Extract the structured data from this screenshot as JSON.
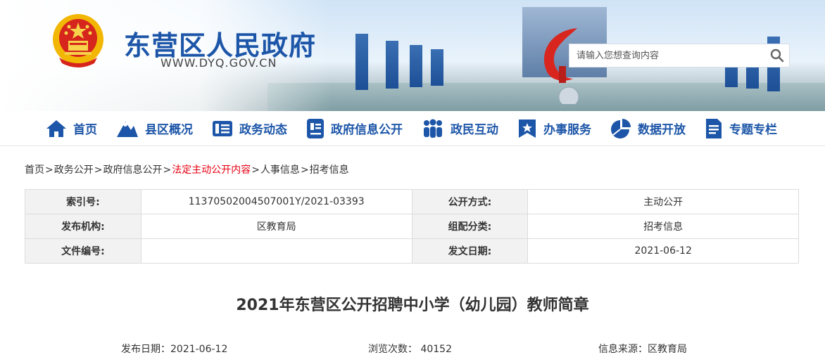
{
  "header": {
    "site_title": "东营区人民政府",
    "site_url": "WWW.DYQ.GOV.CN",
    "search_placeholder": "请输入您想查询内容",
    "brand_color": "#1d56a8"
  },
  "nav": [
    {
      "label": "首页",
      "icon": "home-icon"
    },
    {
      "label": "县区概况",
      "icon": "mountain-icon"
    },
    {
      "label": "政务动态",
      "icon": "news-icon"
    },
    {
      "label": "政府信息公开",
      "icon": "info-card-icon"
    },
    {
      "label": "政民互动",
      "icon": "people-icon"
    },
    {
      "label": "办事服务",
      "icon": "service-bookmark-icon"
    },
    {
      "label": "数据开放",
      "icon": "pie-chart-icon"
    },
    {
      "label": "专题专栏",
      "icon": "document-icon"
    }
  ],
  "breadcrumb": [
    {
      "label": "首页"
    },
    {
      "label": "政务公开"
    },
    {
      "label": "政府信息公开"
    },
    {
      "label": "法定主动公开内容",
      "active": true
    },
    {
      "label": "人事信息"
    },
    {
      "label": "招考信息"
    }
  ],
  "meta_table": [
    [
      {
        "label": "索引号:",
        "value": "11370502004507001Y/2021-03393"
      },
      {
        "label": "公开方式:",
        "value": "主动公开"
      }
    ],
    [
      {
        "label": "发布机构:",
        "value": "区教育局"
      },
      {
        "label": "组配分类:",
        "value": "招考信息"
      }
    ],
    [
      {
        "label": "文件编号:",
        "value": ""
      },
      {
        "label": "发文日期:",
        "value": "2021-06-12"
      }
    ]
  ],
  "article": {
    "title": "2021年东营区公开招聘中小学（幼儿园）教师简章",
    "publish_date": "发布日期：2021-06-12",
    "views": "浏览次数： 40152",
    "source": "信息来源：区教育局"
  }
}
